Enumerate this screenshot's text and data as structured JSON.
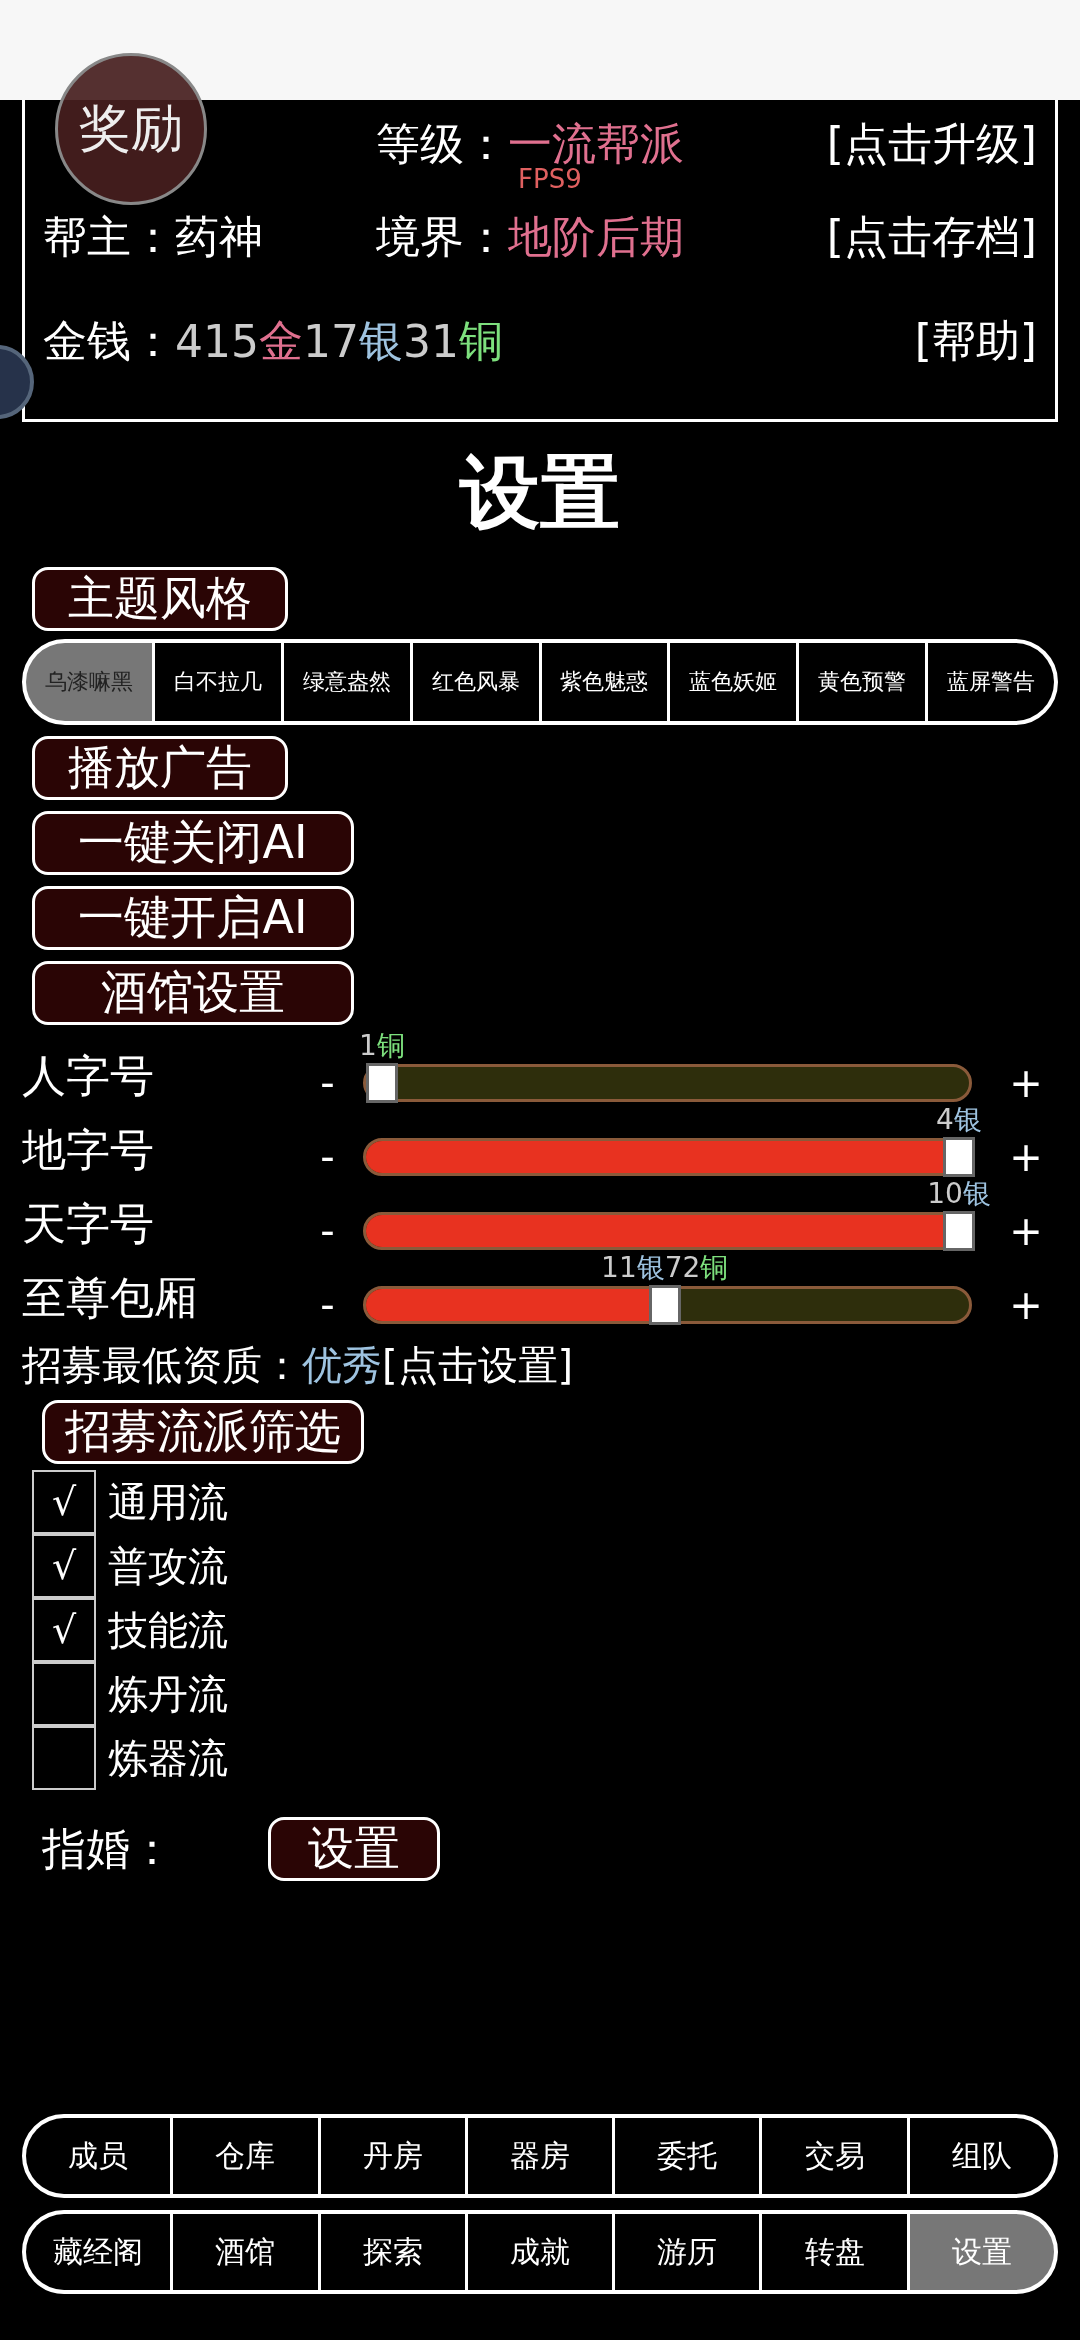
{
  "reward_badge": "奖励",
  "fps": "FPS9",
  "header": {
    "rows": [
      {
        "left_label": "",
        "left_value": "",
        "mid_label": "等级：",
        "mid_value": "一流帮派",
        "action": "[点击升级]"
      },
      {
        "left_label": "帮主：",
        "left_value": "药神",
        "mid_label": "境界：",
        "mid_value": "地阶后期",
        "action": "[点击存档]"
      }
    ],
    "money_label": "金钱：",
    "money": [
      {
        "kind": "number",
        "text": "415"
      },
      {
        "kind": "gold",
        "text": "金"
      },
      {
        "kind": "number",
        "text": "17"
      },
      {
        "kind": "silver",
        "text": "银"
      },
      {
        "kind": "number",
        "text": "31"
      },
      {
        "kind": "copper",
        "text": "铜"
      }
    ],
    "help": "[帮助]"
  },
  "title": "设置",
  "theme_button": "主题风格",
  "themes": [
    {
      "label": "乌漆嘛黑",
      "selected": true
    },
    {
      "label": "白不拉几",
      "selected": false
    },
    {
      "label": "绿意盎然",
      "selected": false
    },
    {
      "label": "红色风暴",
      "selected": false
    },
    {
      "label": "紫色魅惑",
      "selected": false
    },
    {
      "label": "蓝色妖姬",
      "selected": false
    },
    {
      "label": "黄色预警",
      "selected": false
    },
    {
      "label": "蓝屏警告",
      "selected": false
    }
  ],
  "buttons": [
    "播放广告",
    "一键关闭AI",
    "一键开启AI",
    "酒馆设置"
  ],
  "sliders": [
    {
      "name": "人字号",
      "minus": "-",
      "plus": "+",
      "level": 0,
      "reading": [
        {
          "kind": "number",
          "text": "1"
        },
        {
          "kind": "copper",
          "text": "铜"
        }
      ]
    },
    {
      "name": "地字号",
      "minus": "-",
      "plus": "+",
      "level": 1,
      "reading": [
        {
          "kind": "number",
          "text": "4"
        },
        {
          "kind": "silver",
          "text": "银"
        }
      ]
    },
    {
      "name": "天字号",
      "minus": "-",
      "plus": "+",
      "level": 1,
      "reading": [
        {
          "kind": "number",
          "text": "10"
        },
        {
          "kind": "silver",
          "text": "银"
        }
      ]
    },
    {
      "name": "至尊包厢",
      "minus": "-",
      "plus": "+",
      "level": 0.49,
      "reading": [
        {
          "kind": "number",
          "text": "11"
        },
        {
          "kind": "silver",
          "text": "银"
        },
        {
          "kind": "number",
          "text": "72"
        },
        {
          "kind": "copper",
          "text": "铜"
        }
      ]
    }
  ],
  "recruit": {
    "label": "招募最低资质：",
    "value": "优秀",
    "action": "[点击设置]"
  },
  "filter_button": "招募流派筛选",
  "check_glyph": "√",
  "filters": [
    {
      "label": "通用流",
      "checked": true
    },
    {
      "label": "普攻流",
      "checked": true
    },
    {
      "label": "技能流",
      "checked": true
    },
    {
      "label": "炼丹流",
      "checked": false
    },
    {
      "label": "炼器流",
      "checked": false
    }
  ],
  "marriage": {
    "label": "指婚：",
    "button": "设置"
  },
  "nav_rows": [
    [
      {
        "label": "成员",
        "selected": false
      },
      {
        "label": "仓库",
        "selected": false
      },
      {
        "label": "丹房",
        "selected": false
      },
      {
        "label": "器房",
        "selected": false
      },
      {
        "label": "委托",
        "selected": false
      },
      {
        "label": "交易",
        "selected": false
      },
      {
        "label": "组队",
        "selected": false
      }
    ],
    [
      {
        "label": "藏经阁",
        "selected": false
      },
      {
        "label": "酒馆",
        "selected": false
      },
      {
        "label": "探索",
        "selected": false
      },
      {
        "label": "成就",
        "selected": false
      },
      {
        "label": "游历",
        "selected": false
      },
      {
        "label": "转盘",
        "selected": false
      },
      {
        "label": "设置",
        "selected": true
      }
    ]
  ]
}
